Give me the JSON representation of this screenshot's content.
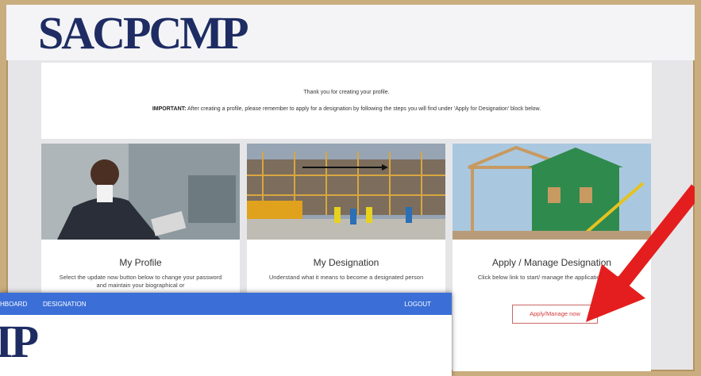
{
  "header": {
    "logo_text": "SACPCMP"
  },
  "notice": {
    "line1": "Thank you for creating your profile.",
    "line2_label": "IMPORTANT:",
    "line2_text": " After creating a profile, please remember to apply for a designation by following the steps you will find under 'Apply for Designation' block below."
  },
  "cards": [
    {
      "title": "My Profile",
      "description": "Select the update now button below to change your password and maintain your biographical or"
    },
    {
      "title": "My Designation",
      "description": "Understand what it means to become a designated person"
    },
    {
      "title": "Apply / Manage Designation",
      "description": "Click below link to start/ manage the application process",
      "button_label": "Apply/Manage now"
    }
  ],
  "overlay": {
    "nav": {
      "item1": "HBOARD",
      "item2": "DESIGNATION",
      "logout": "LOGOUT"
    },
    "logo_text": "IP"
  },
  "colors": {
    "navbar": "#3b6fd7",
    "logo": "#1e2c63",
    "arrow": "#e41e1e",
    "button_text": "#d43b3b"
  }
}
